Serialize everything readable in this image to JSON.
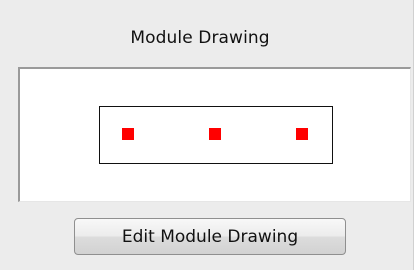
{
  "panel": {
    "title": "Module Drawing"
  },
  "drawing": {
    "pin_color": "#ff0000",
    "outline_color": "#111111",
    "pins": [
      "pin-1",
      "pin-2",
      "pin-3"
    ]
  },
  "actions": {
    "edit_label": "Edit Module Drawing"
  }
}
